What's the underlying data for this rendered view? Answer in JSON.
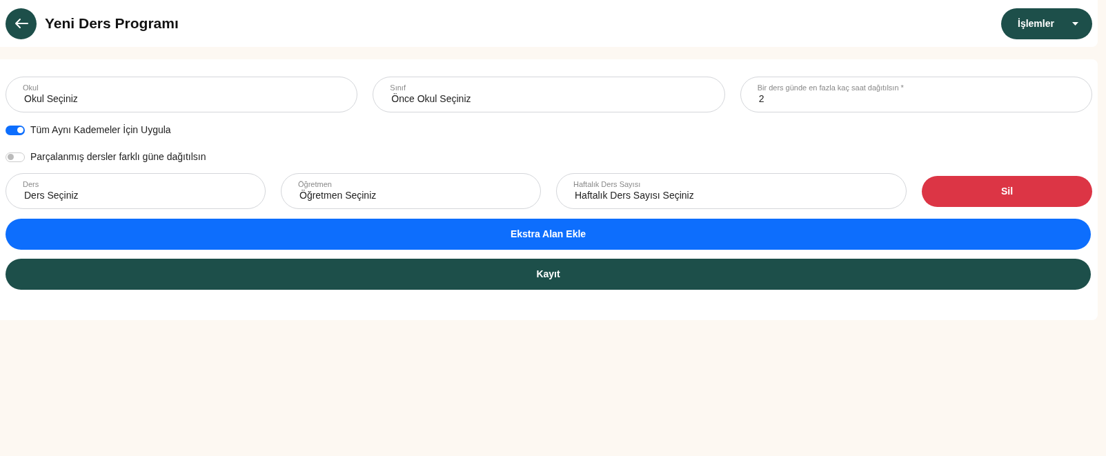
{
  "header": {
    "title": "Yeni Ders Programı",
    "actions_button": "İşlemler"
  },
  "top_fields": [
    {
      "label": "Okul",
      "value": "Okul Seçiniz"
    },
    {
      "label": "Sınıf",
      "value": "Önce Okul Seçiniz"
    },
    {
      "label": "Bir ders günde en fazla kaç saat dağıtılsın *",
      "value": "2"
    }
  ],
  "toggles": [
    {
      "label": "Tüm Aynı Kademeler İçin Uygula",
      "on": true
    },
    {
      "label": "Parçalanmış dersler farklı güne dağıtılsın",
      "on": false
    }
  ],
  "lesson_fields": [
    {
      "label": "Ders",
      "value": "Ders Seçiniz"
    },
    {
      "label": "Öğretmen",
      "value": "Öğretmen Seçiniz"
    },
    {
      "label": "Haftalık Ders Sayısı",
      "value": "Haftalık Ders Sayısı Seçiniz"
    }
  ],
  "delete_button": "Sil",
  "add_button": "Ekstra Alan Ekle",
  "save_button": "Kayıt"
}
